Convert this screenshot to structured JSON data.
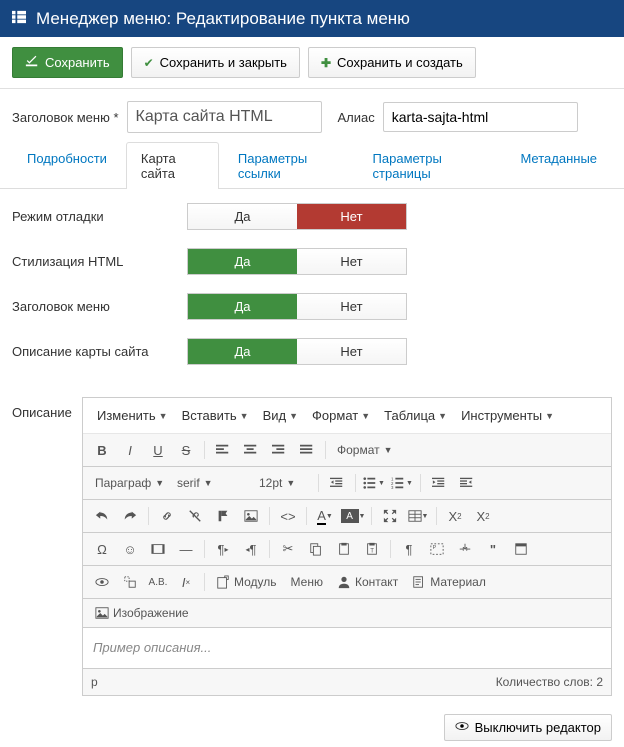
{
  "header": {
    "title": "Менеджер меню: Редактирование пункта меню"
  },
  "actions": {
    "save": "Сохранить",
    "save_close": "Сохранить и закрыть",
    "save_new": "Сохранить и создать"
  },
  "form": {
    "title_label": "Заголовок меню *",
    "title_value": "Карта сайта HTML",
    "alias_label": "Алиас",
    "alias_value": "karta-sajta-html"
  },
  "tabs": [
    "Подробности",
    "Карта сайта",
    "Параметры ссылки",
    "Параметры страницы",
    "Метаданные"
  ],
  "active_tab": 1,
  "toggles": {
    "yes": "Да",
    "no": "Нет",
    "debug": {
      "label": "Режим отладки",
      "value": "no"
    },
    "styling": {
      "label": "Стилизация HTML",
      "value": "yes"
    },
    "menu_title": {
      "label": "Заголовок меню",
      "value": "yes"
    },
    "desc": {
      "label": "Описание карты сайта",
      "value": "yes"
    }
  },
  "editor": {
    "label": "Описание",
    "menus": [
      "Изменить",
      "Вставить",
      "Вид",
      "Формат",
      "Таблица",
      "Инструменты"
    ],
    "format_select": "Формат",
    "paragraph": "Параграф",
    "font_family": "serif",
    "font_size": "12pt",
    "module": "Модуль",
    "menu": "Меню",
    "contact": "Контакт",
    "material": "Материал",
    "image": "Изображение",
    "content": "Пример описания...",
    "path": "p",
    "word_count": "Количество слов: 2",
    "toggle": "Выключить редактор"
  }
}
